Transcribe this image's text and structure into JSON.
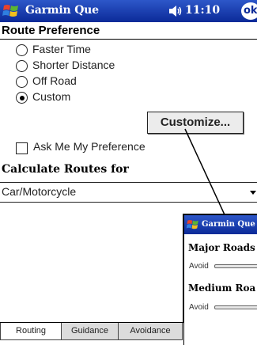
{
  "titlebar": {
    "app_title": "Garmin Que",
    "clock": "11:10",
    "ok_label": "ok",
    "icons": [
      "windows-start-icon",
      "speaker-icon"
    ]
  },
  "route_preference": {
    "heading": "Route Preference",
    "options": [
      {
        "label": "Faster Time",
        "selected": false
      },
      {
        "label": "Shorter Distance",
        "selected": false
      },
      {
        "label": "Off Road",
        "selected": false
      },
      {
        "label": "Custom",
        "selected": true
      }
    ],
    "customize_label": "Customize...",
    "ask_preference_label": "Ask Me My Preference",
    "ask_preference_checked": false
  },
  "calculate": {
    "heading": "Calculate Routes for",
    "selected_value": "Car/Motorcycle"
  },
  "inset": {
    "title": "Garmin Que",
    "major_heading": "Major Roads",
    "medium_heading": "Medium Roa",
    "avoid_label_1": "Avoid",
    "avoid_label_2": "Avoid"
  },
  "tabs": [
    {
      "label": "Routing",
      "active": true
    },
    {
      "label": "Guidance",
      "active": false
    },
    {
      "label": "Avoidance",
      "active": false
    }
  ],
  "colors": {
    "titlebar_top": "#2d57c9",
    "titlebar_bottom": "#0b2a98"
  }
}
